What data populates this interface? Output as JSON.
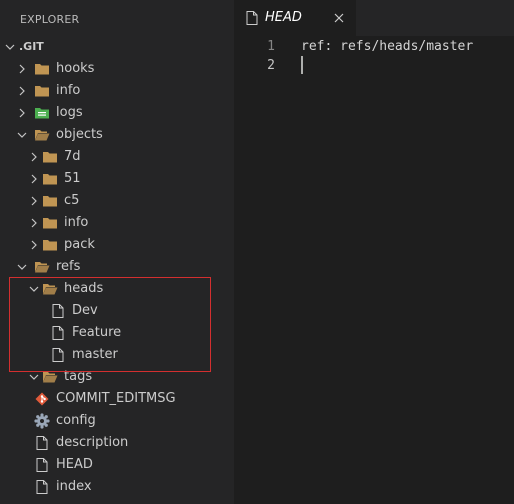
{
  "sidebar": {
    "header": "EXPLORER",
    "tree": [
      {
        "label": ".GIT",
        "type": "root",
        "expanded": true,
        "depth": 0
      },
      {
        "label": "hooks",
        "type": "folder",
        "expanded": false,
        "depth": 1
      },
      {
        "label": "info",
        "type": "folder",
        "expanded": false,
        "depth": 1
      },
      {
        "label": "logs",
        "type": "folder-logs",
        "expanded": false,
        "depth": 1
      },
      {
        "label": "objects",
        "type": "folder",
        "expanded": true,
        "depth": 1
      },
      {
        "label": "7d",
        "type": "folder",
        "expanded": false,
        "depth": 2
      },
      {
        "label": "51",
        "type": "folder",
        "expanded": false,
        "depth": 2
      },
      {
        "label": "c5",
        "type": "folder",
        "expanded": false,
        "depth": 2
      },
      {
        "label": "info",
        "type": "folder",
        "expanded": false,
        "depth": 2
      },
      {
        "label": "pack",
        "type": "folder",
        "expanded": false,
        "depth": 2
      },
      {
        "label": "refs",
        "type": "folder",
        "expanded": true,
        "depth": 1
      },
      {
        "label": "heads",
        "type": "folder",
        "expanded": true,
        "depth": 2
      },
      {
        "label": "Dev",
        "type": "file",
        "depth": 3
      },
      {
        "label": "Feature",
        "type": "file",
        "depth": 3
      },
      {
        "label": "master",
        "type": "file",
        "depth": 3
      },
      {
        "label": "tags",
        "type": "folder",
        "expanded": true,
        "depth": 2
      },
      {
        "label": "COMMIT_EDITMSG",
        "type": "git-file",
        "depth": 1
      },
      {
        "label": "config",
        "type": "config-file",
        "depth": 1
      },
      {
        "label": "description",
        "type": "file",
        "depth": 1
      },
      {
        "label": "HEAD",
        "type": "file",
        "depth": 1
      },
      {
        "label": "index",
        "type": "file",
        "depth": 1
      }
    ]
  },
  "tab": {
    "label": "HEAD",
    "icon": "file-icon",
    "close_icon": "close-icon"
  },
  "editor": {
    "lines": [
      {
        "number": "1",
        "text": "ref: refs/heads/master"
      },
      {
        "number": "2",
        "text": ""
      }
    ]
  },
  "colors": {
    "folder": "#c09553",
    "logs_folder": "#4caf50",
    "git_file": "#e05a3a",
    "highlight_border": "#d32f2f"
  }
}
